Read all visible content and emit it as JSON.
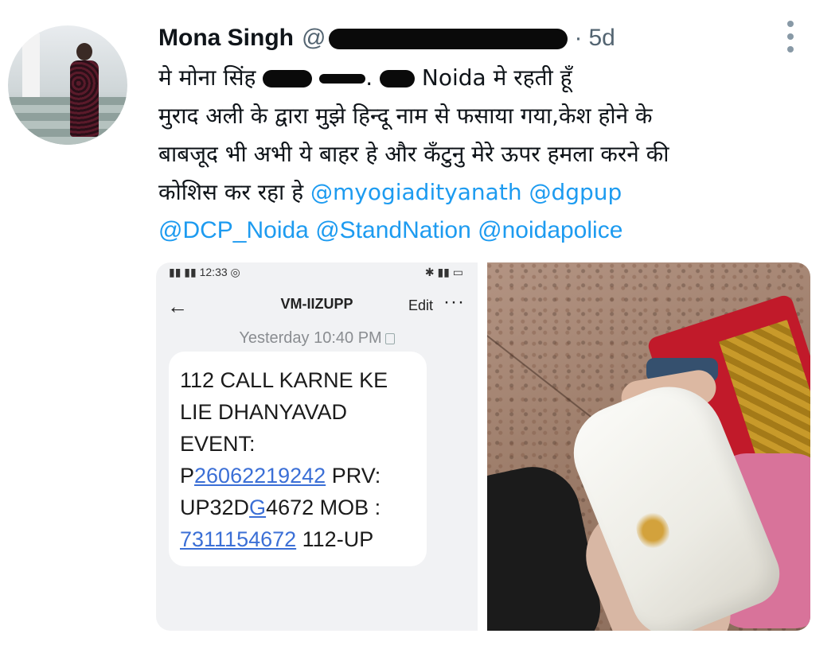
{
  "tweet": {
    "author_name": "Mona Singh",
    "author_handle_prefix": "@",
    "separator": "·",
    "time": "5d",
    "text": {
      "line1_prefix": "मे मोना सिंह",
      "line1_suffix": "Noida मे रहती हूँ",
      "line2": "मुराद अली के द्वारा मुझे हिन्दू नाम से फसाया गया,केश होने के",
      "line3": "बाबजूद भी अभी ये बाहर हे और कँटुनु मेरे ऊपर हमला करने की",
      "line4_prefix": "कोशिस कर रहा हे"
    },
    "mentions": [
      "@myogiadityanath",
      "@dgpup",
      "@DCP_Noida",
      "@StandNation",
      "@noidapolice"
    ]
  },
  "icons": {
    "more": "more-vertical-icon",
    "back": "back-arrow-icon"
  },
  "sms": {
    "status_time": "12:33",
    "sender": "VM-IIZUPP",
    "edit_label": "Edit",
    "more_label": "···",
    "back_label": "←",
    "timestamp": "Yesterday 10:40 PM",
    "message": {
      "l1": "112 CALL KARNE KE",
      "l2": "LIE DHANYAVAD",
      "l3": "EVENT:",
      "l4_a": "P",
      "l4_link": "26062219242",
      "l4_b": " PRV:",
      "l5_a": "UP32D",
      "l5_link": "G",
      "l5_b": "4672 MOB :",
      "l6_link": "7311154672",
      "l6_b": " 112-UP"
    }
  },
  "colors": {
    "link": "#1d9bf0",
    "muted": "#536471",
    "sms_link": "#3b6fd6"
  }
}
